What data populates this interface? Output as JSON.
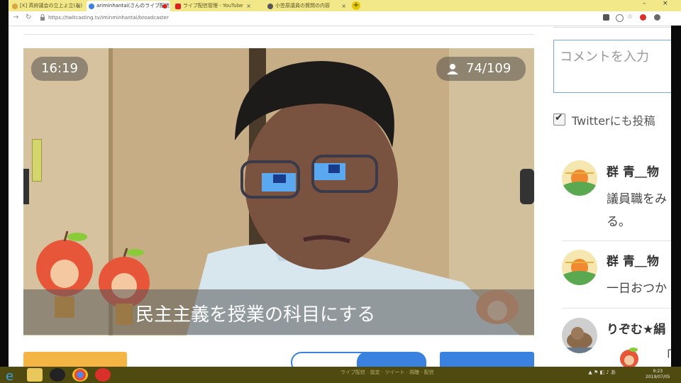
{
  "browser": {
    "tabs": [
      {
        "title": "[X] 高府議会の立上よ立(右)",
        "active": false,
        "favicon_color": "#d8a640"
      },
      {
        "title": "ariminhantai(さんのライブ配信",
        "active": true,
        "favicon_color": "#3b82e0"
      },
      {
        "title": "ライブ配信管理 - YouTube",
        "active": false,
        "favicon_color": "#e02020"
      },
      {
        "title": "小笠原議員の質問の内容",
        "active": false,
        "favicon_color": "#555555"
      }
    ],
    "new_tab": "+",
    "url": "https://twitcasting.tv/iminminhantai/broadcaster",
    "window_controls": [
      "–",
      "×"
    ]
  },
  "player": {
    "elapsed": "16:19",
    "viewers": "74/109",
    "caption": "民主主義を授業の科目にする"
  },
  "comment_panel": {
    "placeholder": "コメントを入力",
    "twitter_label": "Twitterにも投稿",
    "twitter_checked": true,
    "comments": [
      {
        "name": "群 青＿物",
        "lines": [
          "議員職をみ",
          "る。"
        ]
      },
      {
        "name": "群 青＿物",
        "lines": [
          "一日おつか"
        ]
      },
      {
        "name": "りぞむ★絹",
        "lines": [
          "「"
        ]
      }
    ]
  },
  "taskbar": {
    "clock_time": "9:23",
    "clock_date": "2019/07/05",
    "ghost_text": "ライブ配信 · 設定 · ツイート · 視聴 · 配信"
  },
  "colors": {
    "accent_blue": "#3b82e0",
    "orange": "#f4b545",
    "tabstrip": "#f2e88a",
    "taskbar": "#4f4a0f"
  }
}
